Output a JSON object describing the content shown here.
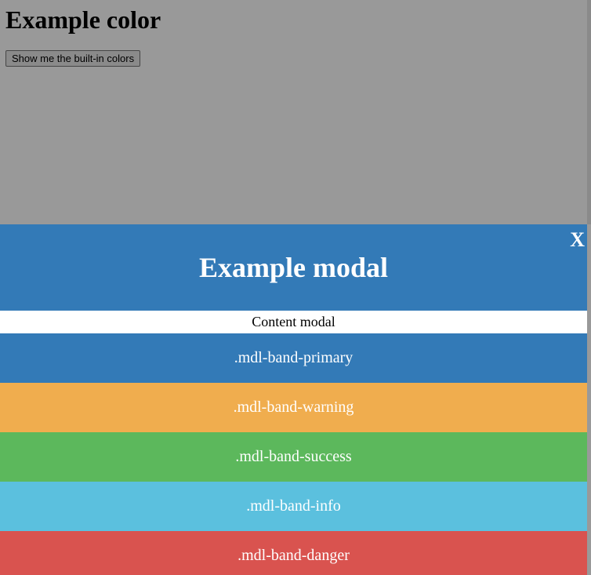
{
  "page": {
    "title": "Example color",
    "button_label": "Show me the built-in colors"
  },
  "modal": {
    "title": "Example modal",
    "close_label": "X",
    "content": "Content modal",
    "bands": [
      {
        "label": ".mdl-band-primary",
        "color": "#337ab7"
      },
      {
        "label": ".mdl-band-warning",
        "color": "#f0ad4e"
      },
      {
        "label": ".mdl-band-success",
        "color": "#5cb85c"
      },
      {
        "label": ".mdl-band-info",
        "color": "#5bc0de"
      },
      {
        "label": ".mdl-band-danger",
        "color": "#d9534f"
      }
    ]
  },
  "colors": {
    "overlay": "rgba(0,0,0,0.4)",
    "header": "#337ab7"
  }
}
